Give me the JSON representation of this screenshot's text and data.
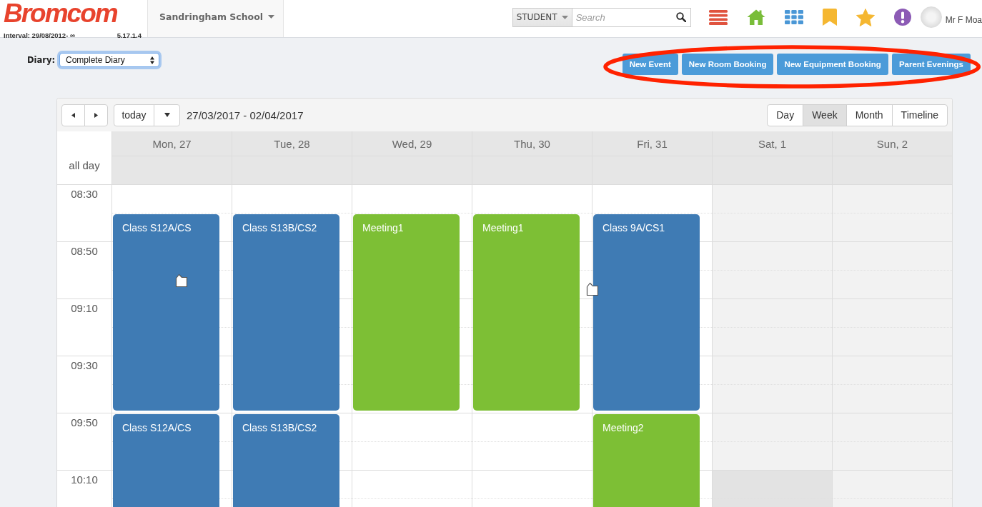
{
  "header": {
    "logo": "Bromcom",
    "interval": "Interval: 29/08/2012- ∞",
    "version": "5.17.1.4",
    "school": "Sandringham School",
    "search": {
      "scope": "STUDENT",
      "placeholder": "Search"
    },
    "user": "Mr F Moa"
  },
  "diary": {
    "label": "Diary:",
    "value": "Complete Diary",
    "focused": true
  },
  "actions": {
    "highlighted": true,
    "buttons": [
      "New Event",
      "New Room Booking",
      "New Equipment Booking",
      "Parent Evenings"
    ]
  },
  "calendar": {
    "today_button": "today",
    "date_range": "27/03/2017 - 02/04/2017",
    "views": [
      {
        "label": "Day",
        "selected": false
      },
      {
        "label": "Week",
        "selected": true
      },
      {
        "label": "Month",
        "selected": false
      },
      {
        "label": "Timeline",
        "selected": false
      }
    ],
    "all_day_label": "all day",
    "time_slots": [
      "08:30",
      "08:50",
      "09:10",
      "09:30",
      "09:50",
      "10:10"
    ],
    "days": [
      {
        "label": "Mon, 27",
        "weekend": false,
        "shaded_slots": [
          false,
          false,
          false,
          false,
          false,
          false
        ],
        "events": [
          {
            "title": "Class S12A/CS",
            "color": "#3f7bb4"
          },
          {
            "title": "Class S12A/CS",
            "color": "#3f7bb4"
          }
        ]
      },
      {
        "label": "Tue, 28",
        "weekend": false,
        "shaded_slots": [
          false,
          false,
          false,
          false,
          false,
          false
        ],
        "events": [
          {
            "title": "Class S13B/CS2",
            "color": "#3f7bb4"
          },
          {
            "title": "Class S13B/CS2",
            "color": "#3f7bb4"
          }
        ]
      },
      {
        "label": "Wed, 29",
        "weekend": false,
        "shaded_slots": [
          false,
          false,
          false,
          false,
          false,
          false
        ],
        "events": [
          {
            "title": "Meeting1",
            "color": "#7dbf35"
          }
        ]
      },
      {
        "label": "Thu, 30",
        "weekend": false,
        "shaded_slots": [
          false,
          false,
          false,
          false,
          false,
          false
        ],
        "events": [
          {
            "title": "Meeting1",
            "color": "#7dbf35"
          }
        ]
      },
      {
        "label": "Fri, 31",
        "weekend": false,
        "shaded_slots": [
          false,
          false,
          false,
          false,
          false,
          false
        ],
        "events": [
          {
            "title": "Class 9A/CS1",
            "color": "#3f7bb4"
          },
          {
            "title": "Meeting2",
            "color": "#7dbf35"
          }
        ]
      },
      {
        "label": "Sat, 1",
        "weekend": true,
        "shaded_slots": [
          false,
          false,
          false,
          false,
          false,
          true
        ]
      },
      {
        "label": "Sun, 2",
        "weekend": true,
        "shaded_slots": [
          false,
          false,
          false,
          false,
          false,
          false
        ]
      }
    ]
  }
}
